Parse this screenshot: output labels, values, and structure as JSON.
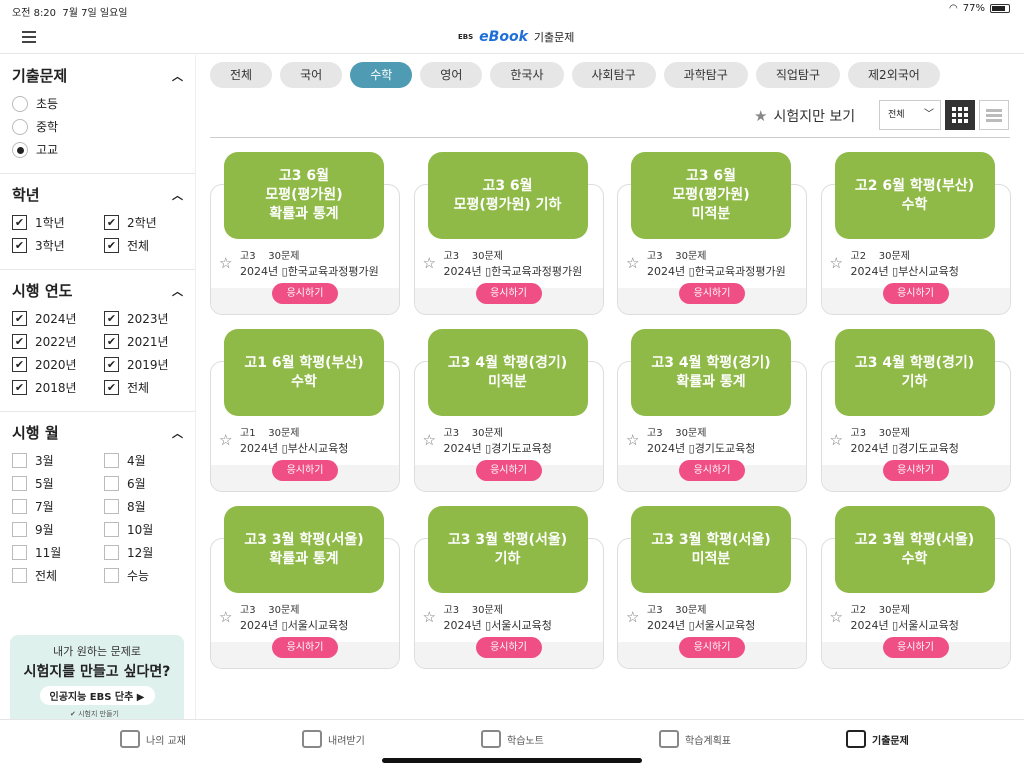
{
  "status": {
    "time": "오전 8:20",
    "date": "7월 7일 일요일",
    "battery": "77%"
  },
  "header": {
    "brand_small": "EBS",
    "brand": "eBook",
    "title": "기출문제"
  },
  "sidebar": {
    "exam": {
      "title": "기출문제",
      "options": [
        "초등",
        "중학",
        "고교"
      ]
    },
    "grade": {
      "title": "학년",
      "items": [
        "1학년",
        "2학년",
        "3학년",
        "전체"
      ]
    },
    "year": {
      "title": "시행 연도",
      "items": [
        "2024년",
        "2023년",
        "2022년",
        "2021년",
        "2020년",
        "2019년",
        "2018년",
        "전체"
      ]
    },
    "month": {
      "title": "시행 월",
      "items": [
        "3월",
        "4월",
        "5월",
        "6월",
        "7월",
        "8월",
        "9월",
        "10월",
        "11월",
        "12월",
        "전체",
        "수능"
      ]
    },
    "banner": {
      "line1": "내가 원하는 문제로",
      "line2": "시험지를 만들고 싶다면?",
      "cta": "인공지능 EBS 단추 ▶",
      "note": "✔ 시험지 만들기"
    }
  },
  "tabs": [
    "전체",
    "국어",
    "수학",
    "영어",
    "한국사",
    "사회탐구",
    "과학탐구",
    "직업탐구",
    "제2외국어"
  ],
  "toolbar": {
    "fav_label": "시험지만 보기",
    "select_value": "전체"
  },
  "cards": [
    {
      "title": "고3 6월\n모평(평가원)\n확률과 통계",
      "grade": "고3",
      "count": "30문제",
      "year": "2024년",
      "org": "한국교육과정평가원",
      "button": "응시하기"
    },
    {
      "title": "고3 6월\n모평(평가원) 기하",
      "grade": "고3",
      "count": "30문제",
      "year": "2024년",
      "org": "한국교육과정평가원",
      "button": "응시하기"
    },
    {
      "title": "고3 6월\n모평(평가원)\n미적분",
      "grade": "고3",
      "count": "30문제",
      "year": "2024년",
      "org": "한국교육과정평가원",
      "button": "응시하기"
    },
    {
      "title": "고2 6월 학평(부산)\n수학",
      "grade": "고2",
      "count": "30문제",
      "year": "2024년",
      "org": "부산시교육청",
      "button": "응시하기"
    },
    {
      "title": "고1 6월 학평(부산)\n수학",
      "grade": "고1",
      "count": "30문제",
      "year": "2024년",
      "org": "부산시교육청",
      "button": "응시하기"
    },
    {
      "title": "고3 4월 학평(경기)\n미적분",
      "grade": "고3",
      "count": "30문제",
      "year": "2024년",
      "org": "경기도교육청",
      "button": "응시하기"
    },
    {
      "title": "고3 4월 학평(경기)\n확률과 통계",
      "grade": "고3",
      "count": "30문제",
      "year": "2024년",
      "org": "경기도교육청",
      "button": "응시하기"
    },
    {
      "title": "고3 4월 학평(경기)\n기하",
      "grade": "고3",
      "count": "30문제",
      "year": "2024년",
      "org": "경기도교육청",
      "button": "응시하기"
    },
    {
      "title": "고3 3월 학평(서울)\n확률과 통계",
      "grade": "고3",
      "count": "30문제",
      "year": "2024년",
      "org": "서울시교육청",
      "button": "응시하기"
    },
    {
      "title": "고3 3월 학평(서울)\n기하",
      "grade": "고3",
      "count": "30문제",
      "year": "2024년",
      "org": "서울시교육청",
      "button": "응시하기"
    },
    {
      "title": "고3 3월 학평(서울)\n미적분",
      "grade": "고3",
      "count": "30문제",
      "year": "2024년",
      "org": "서울시교육청",
      "button": "응시하기"
    },
    {
      "title": "고2 3월 학평(서울)\n수학",
      "grade": "고2",
      "count": "30문제",
      "year": "2024년",
      "org": "서울시교육청",
      "button": "응시하기"
    }
  ],
  "bottom_nav": [
    "나의 교재",
    "내려받기",
    "학습노트",
    "학습계획표",
    "기출문제"
  ]
}
